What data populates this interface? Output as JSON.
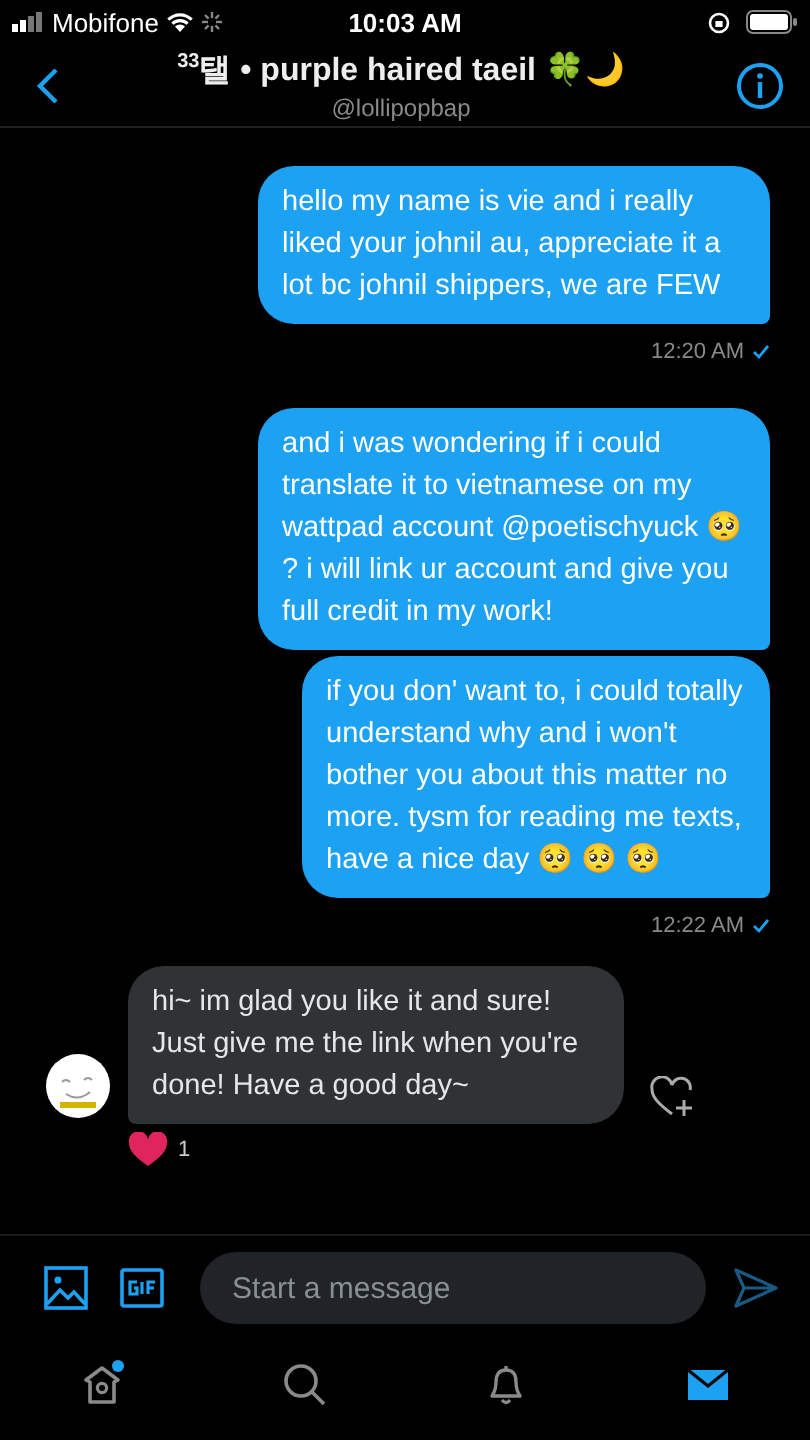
{
  "status_bar": {
    "carrier": "Mobifone",
    "time": "10:03 AM"
  },
  "header": {
    "title": "$^{33}$탤 • purple haired taeil 🍀🌙",
    "handle": "@lollipopbap"
  },
  "messages": [
    {
      "kind": "sent",
      "text": "hello my name is vie and i really liked your johnil au, appreciate it a lot bc johnil shippers, we are FEW",
      "time": "12:20 AM"
    },
    {
      "kind": "sent",
      "text": "and i was wondering if i could translate it to vietnamese on my wattpad account @poetischyuck 🥺 ? i will link ur account and give you full credit in my work!"
    },
    {
      "kind": "sent",
      "text": "if you don' want to, i could totally understand why and i won't bother you about this matter no more. tysm for reading me texts, have a nice day 🥺 🥺 🥺",
      "time": "12:22 AM"
    },
    {
      "kind": "received",
      "text": "hi~ im glad you like it and sure! Just give me the link when you're done! Have a good day~",
      "likes": "1"
    }
  ],
  "composer": {
    "placeholder": "Start a message"
  },
  "tabs": [
    {
      "kind": "home",
      "selected": false,
      "badge": true
    },
    {
      "kind": "search",
      "selected": false,
      "badge": false
    },
    {
      "kind": "notifications",
      "selected": false,
      "badge": false
    },
    {
      "kind": "messages",
      "selected": true,
      "badge": false
    }
  ]
}
